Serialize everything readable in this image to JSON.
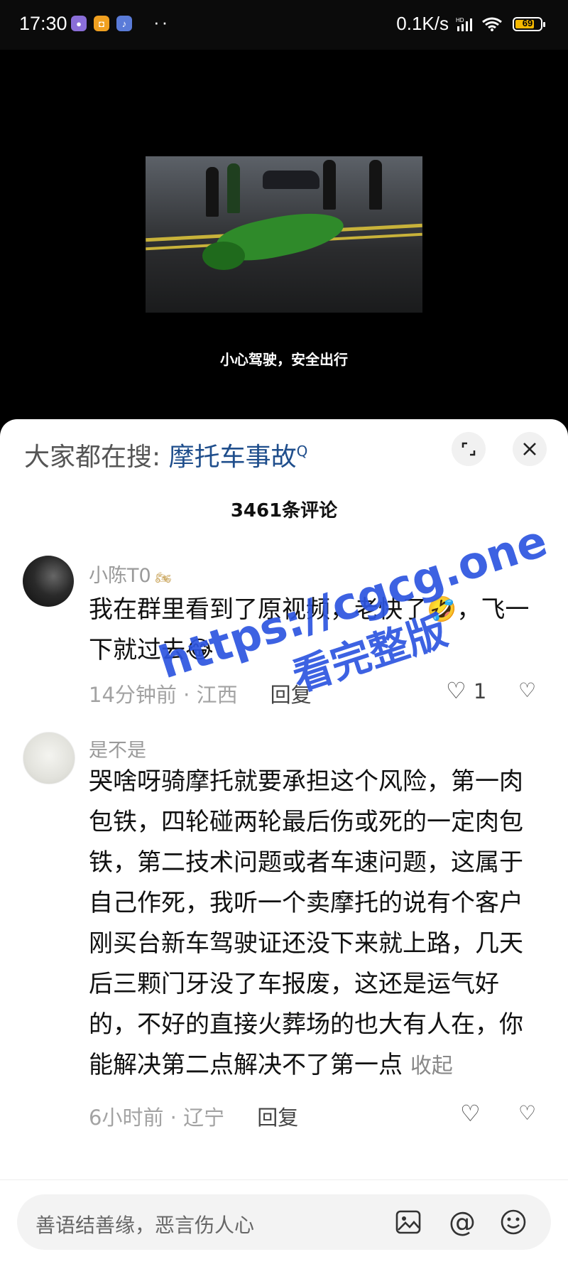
{
  "status_bar": {
    "time": "17:30",
    "app_icons": [
      "messages-icon",
      "wallet-icon",
      "douyin-icon"
    ],
    "more": "··",
    "net_speed": "0.1K/s",
    "network": "HD",
    "battery": "69"
  },
  "video": {
    "caption": "小心驾驶，安全出行"
  },
  "comments_sheet": {
    "search_prefix": "大家都在搜:",
    "search_term": "摩托车事故",
    "count_label": "3461条评论",
    "comments": [
      {
        "username": "小陈T0",
        "text": "我在群里看到了原视频，老快了🤣，飞一下就过去😂",
        "time": "14分钟前",
        "location": "江西",
        "reply_label": "回复",
        "likes": "1"
      },
      {
        "username": "是不是",
        "text": "哭啥呀骑摩托就要承担这个风险，第一肉包铁，四轮碰两轮最后伤或死的一定肉包铁，第二技术问题或者车速问题，这属于自己作死，我听一个卖摩托的说有个客户刚买台新车驾驶证还没下来就上路，几天后三颗门牙没了车报废，这还是运气好的，不好的直接火葬场的也大有人在，你能解决第二点解决不了第一点",
        "collapse_label": "收起",
        "time": "6小时前",
        "location": "辽宁",
        "reply_label": "回复"
      }
    ]
  },
  "watermark": {
    "url": "https://cgcg.one",
    "slogan": "看完整版"
  },
  "input_bar": {
    "placeholder": "善语结善缘，恶言伤人心"
  },
  "colors": {
    "accent": "#1f4e8c",
    "watermark": "#2d55e0",
    "battery": "#f5b800"
  }
}
